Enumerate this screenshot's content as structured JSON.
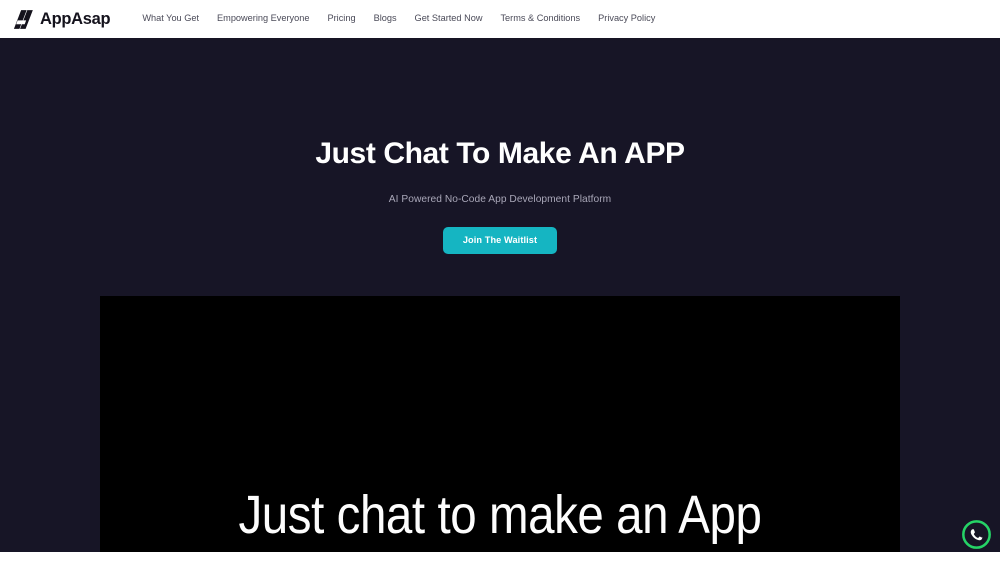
{
  "header": {
    "logo": {
      "icon": "appasap-a-logo-icon",
      "text": "AppAsap"
    },
    "nav_items": [
      {
        "label": "What You Get",
        "name": "nav-link-what-you-get"
      },
      {
        "label": "Empowering Everyone",
        "name": "nav-link-empowering-everyone"
      },
      {
        "label": "Pricing",
        "name": "nav-link-pricing"
      },
      {
        "label": "Blogs",
        "name": "nav-link-blogs"
      },
      {
        "label": "Get Started Now",
        "name": "nav-link-get-started-now"
      },
      {
        "label": "Terms & Conditions",
        "name": "nav-link-terms-and-conditions"
      },
      {
        "label": "Privacy Policy",
        "name": "nav-link-privacy-policy"
      }
    ]
  },
  "hero": {
    "title": "Just Chat To Make An APP",
    "subtitle": "AI Powered No-Code App Development Platform",
    "cta_label": "Join The Waitlist",
    "background_color": "#171526",
    "title_color": "#ffffff",
    "subtitle_color": "#a9a7b8",
    "accent_color": "#15b5c2"
  },
  "media": {
    "caption": "Just chat to make an App",
    "background_color": "#000000",
    "caption_color": "#fdfdfd"
  },
  "floating_actions": {
    "whatsapp": {
      "icon": "whatsapp-icon",
      "label": "Chat on WhatsApp",
      "color": "#25d366"
    }
  }
}
